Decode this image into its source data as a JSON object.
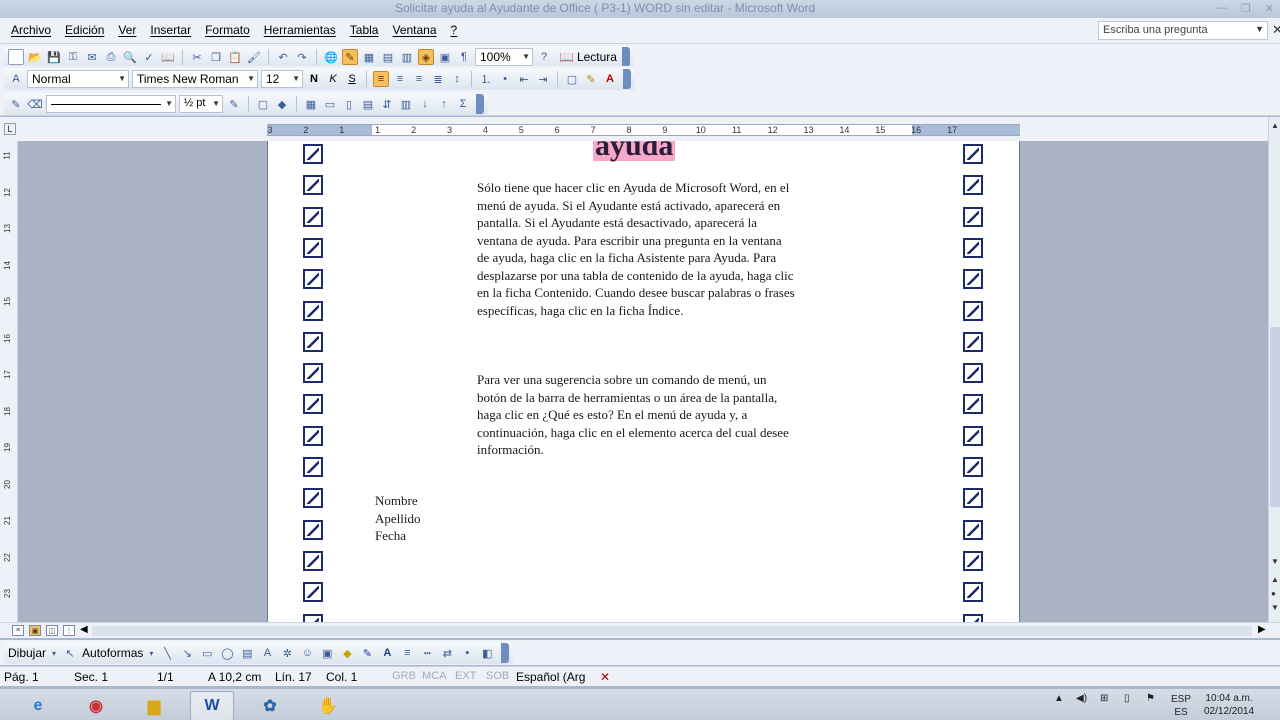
{
  "window": {
    "title": "Solicitar ayuda al Ayudante de Office ( P3-1) WORD sin editar - Microsoft Word"
  },
  "menu": {
    "items": [
      "Archivo",
      "Edición",
      "Ver",
      "Insertar",
      "Formato",
      "Herramientas",
      "Tabla",
      "Ventana",
      "?"
    ],
    "ask_placeholder": "Escriba una pregunta"
  },
  "toolbar": {
    "zoom": "100%",
    "reading_label": "Lectura",
    "style": "Normal",
    "font": "Times New Roman",
    "size": "12",
    "bold": "N",
    "italic": "K",
    "underline": "S",
    "line_weight": "½ pt"
  },
  "ruler": {
    "numbers": [
      "3",
      "2",
      "1",
      "1",
      "2",
      "3",
      "4",
      "5",
      "6",
      "7",
      "8",
      "9",
      "10",
      "11",
      "12",
      "13",
      "14",
      "15",
      "16",
      "17"
    ]
  },
  "vruler": {
    "numbers": [
      "11",
      "12",
      "13",
      "14",
      "15",
      "16",
      "17",
      "18",
      "19",
      "20",
      "21",
      "22",
      "23"
    ]
  },
  "document": {
    "heading_fragment": "ayuda",
    "paragraph1": "Sólo tiene que hacer clic en Ayuda de Microsoft Word, en el menú de ayuda. Si el Ayudante está activado, aparecerá en pantalla. Si el Ayudante está desactivado, aparecerá la ventana de ayuda. Para escribir una pregunta en la ventana de ayuda, haga clic en la ficha Asistente para Ayuda. Para desplazarse por una tabla de contenido de la ayuda, haga clic en la ficha Contenido. Cuando desee buscar palabras o frases específicas, haga clic en la ficha Índice.",
    "paragraph2": "Para ver una sugerencia sobre un comando de menú, un botón de la barra de herramientas o un área de la pantalla, haga clic en ¿Qué es esto? En el menú de ayuda y, a continuación, haga clic en el elemento acerca del cual desee información.",
    "signature": [
      "Nombre",
      "Apellido",
      "Fecha"
    ]
  },
  "drawing": {
    "draw_label": "Dibujar",
    "autoshapes_label": "Autoformas"
  },
  "status": {
    "page": "Pág. 1",
    "section": "Sec. 1",
    "pages": "1/1",
    "at": "A 10,2 cm",
    "line": "Lín. 17",
    "col": "Col. 1",
    "grb": "GRB",
    "mca": "MCA",
    "ext": "EXT",
    "sob": "SOB",
    "language": "Español (Arg"
  },
  "taskbar": {
    "lang1": "ESP",
    "lang2": "ES",
    "time": "10:04 a.m.",
    "date": "02/12/2014"
  }
}
